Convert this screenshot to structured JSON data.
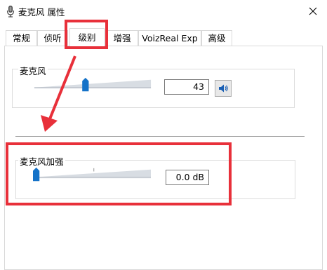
{
  "window": {
    "title": "麦克风 属性",
    "icon": "microphone-icon",
    "close_icon": "close-icon"
  },
  "tabs": [
    {
      "label": "常规",
      "active": false
    },
    {
      "label": "侦听",
      "active": false
    },
    {
      "label": "级别",
      "active": true
    },
    {
      "label": "增强",
      "active": false
    },
    {
      "label": "VoizReal Exp",
      "active": false
    },
    {
      "label": "高级",
      "active": false
    }
  ],
  "levels": {
    "microphone": {
      "label": "麦克风",
      "value": "43",
      "slider_fraction": 0.43,
      "mute_icon": "speaker-icon"
    },
    "boost": {
      "label": "麦克风加强",
      "value": "0.0 dB",
      "slider_fraction": 0.0
    }
  },
  "annotation": {
    "color": "#e8303a"
  }
}
